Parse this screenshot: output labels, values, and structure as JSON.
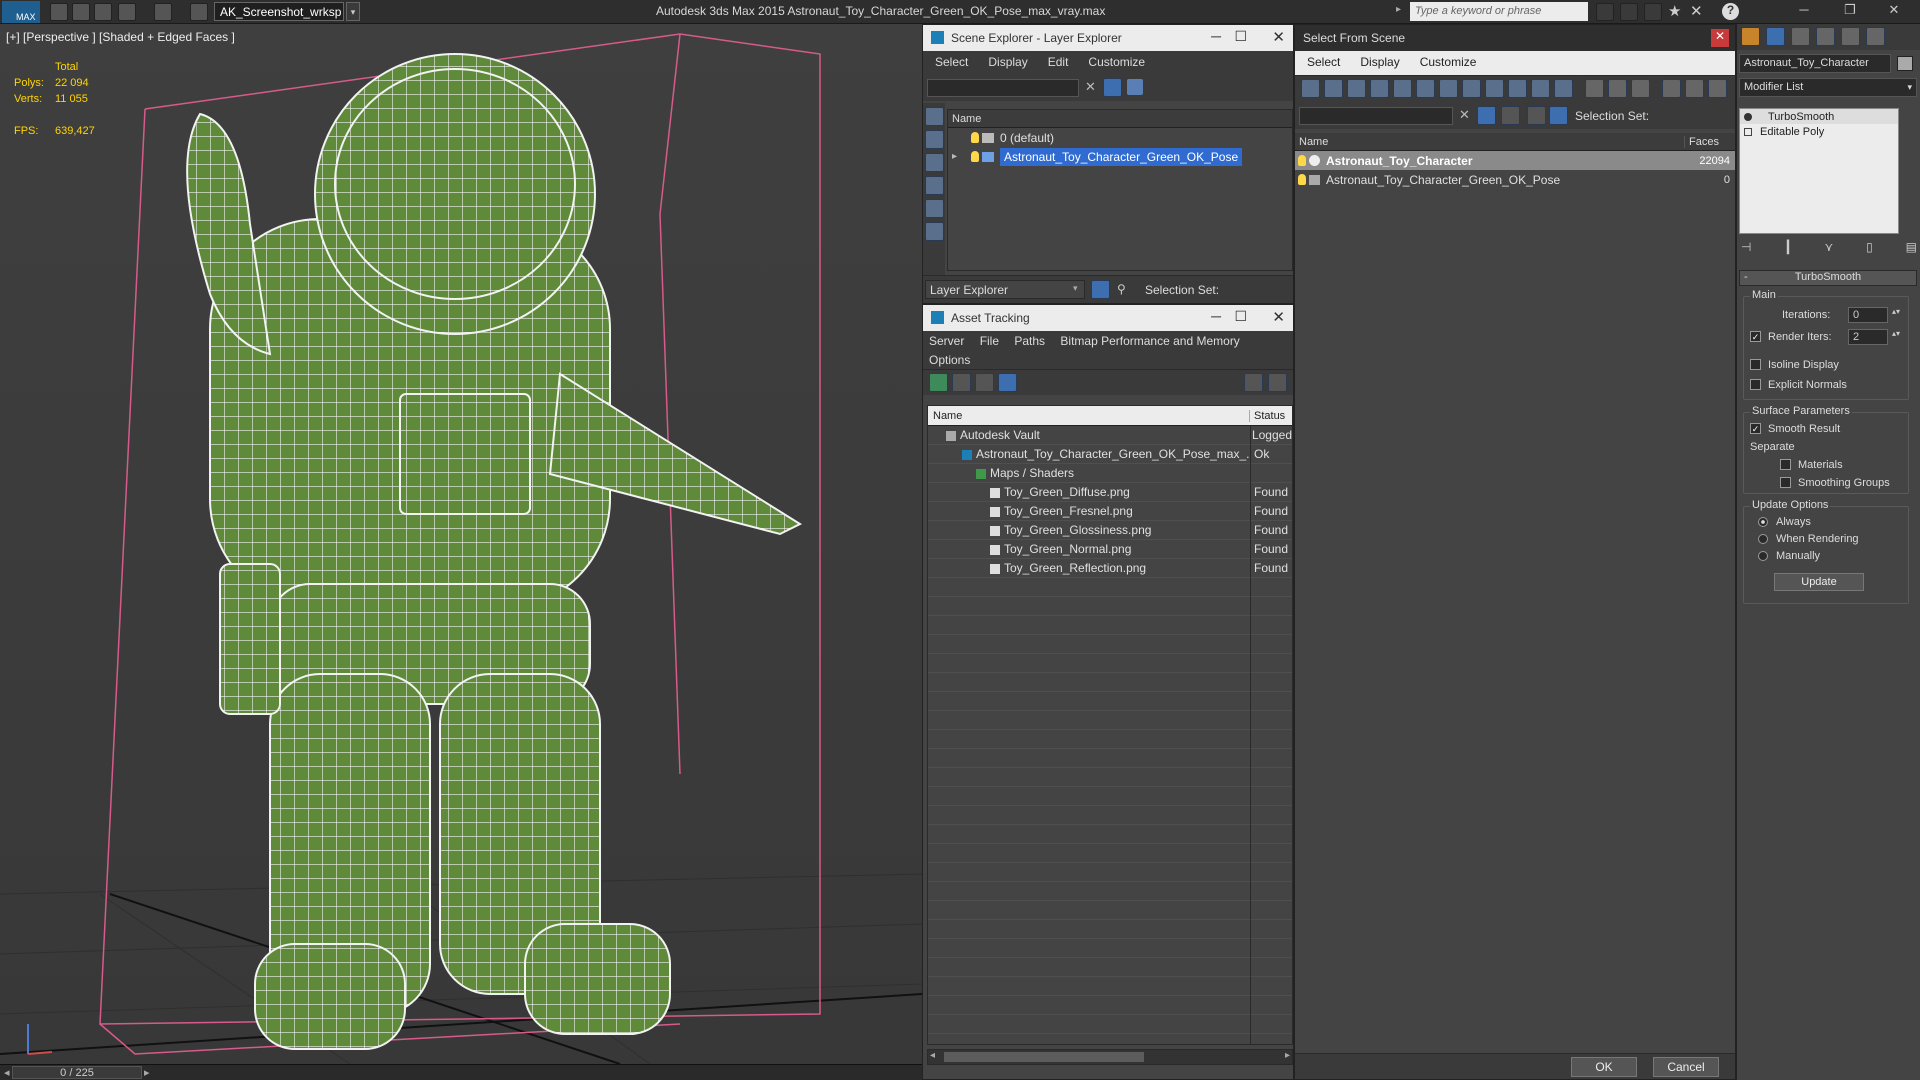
{
  "app": {
    "title": "Autodesk 3ds Max  2015    Astronaut_Toy_Character_Green_OK_Pose_max_vray.max",
    "workspace": "AK_Screenshot_wrksp",
    "search_placeholder": "Type a keyword or phrase",
    "logo": "MAX"
  },
  "viewport": {
    "label": "[+] [Perspective ] [Shaded + Edged Faces ]",
    "stats": {
      "total_label": "Total",
      "polys_label": "Polys:",
      "polys_value": "22 094",
      "verts_label": "Verts:",
      "verts_value": "11 055",
      "fps_label": "FPS:",
      "fps_value": "639,427"
    },
    "timeline": "0 / 225"
  },
  "scene_explorer": {
    "title": "Scene Explorer - Layer Explorer",
    "menu": [
      "Select",
      "Display",
      "Edit",
      "Customize"
    ],
    "column_name": "Name",
    "rows": [
      {
        "label": "0 (default)"
      },
      {
        "label": "Astronaut_Toy_Character_Green_OK_Pose"
      }
    ],
    "footer_dropdown": "Layer Explorer",
    "selection_set_label": "Selection Set:"
  },
  "asset_tracking": {
    "title": "Asset Tracking",
    "menu": [
      "Server",
      "File",
      "Paths",
      "Bitmap Performance and Memory"
    ],
    "menu2": "Options",
    "col_name": "Name",
    "col_status": "Status",
    "rows": [
      {
        "name": "Autodesk Vault",
        "status": "Logged"
      },
      {
        "name": "Astronaut_Toy_Character_Green_OK_Pose_max_...",
        "status": "Ok"
      },
      {
        "name": "Maps / Shaders",
        "status": ""
      },
      {
        "name": "Toy_Green_Diffuse.png",
        "status": "Found"
      },
      {
        "name": "Toy_Green_Fresnel.png",
        "status": "Found"
      },
      {
        "name": "Toy_Green_Glossiness.png",
        "status": "Found"
      },
      {
        "name": "Toy_Green_Normal.png",
        "status": "Found"
      },
      {
        "name": "Toy_Green_Reflection.png",
        "status": "Found"
      }
    ]
  },
  "select_from_scene": {
    "title": "Select From Scene",
    "menu": [
      "Select",
      "Display",
      "Customize"
    ],
    "selection_set_label": "Selection Set:",
    "col_name": "Name",
    "col_faces": "Faces",
    "rows": [
      {
        "name": "Astronaut_Toy_Character",
        "faces": "22094"
      },
      {
        "name": "Astronaut_Toy_Character_Green_OK_Pose",
        "faces": "0"
      }
    ],
    "ok": "OK",
    "cancel": "Cancel"
  },
  "command_panel": {
    "object_name": "Astronaut_Toy_Character",
    "modifier_list": "Modifier List",
    "stack": [
      "TurboSmooth",
      "Editable Poly"
    ],
    "rollout_title": "TurboSmooth",
    "main_label": "Main",
    "iterations_label": "Iterations:",
    "iterations_value": "0",
    "render_iters_label": "Render Iters:",
    "render_iters_value": "2",
    "isoline_display": "Isoline Display",
    "explicit_normals": "Explicit Normals",
    "surface_parameters": "Surface Parameters",
    "smooth_result": "Smooth Result",
    "separate": "Separate",
    "materials": "Materials",
    "smoothing_groups": "Smoothing Groups",
    "update_options": "Update Options",
    "always": "Always",
    "when_rendering": "When Rendering",
    "manually": "Manually",
    "update_button": "Update"
  },
  "colors": {
    "selection": "#2f6bd1",
    "stats_text": "#ffd400",
    "model_green": "#5e8a3a"
  }
}
